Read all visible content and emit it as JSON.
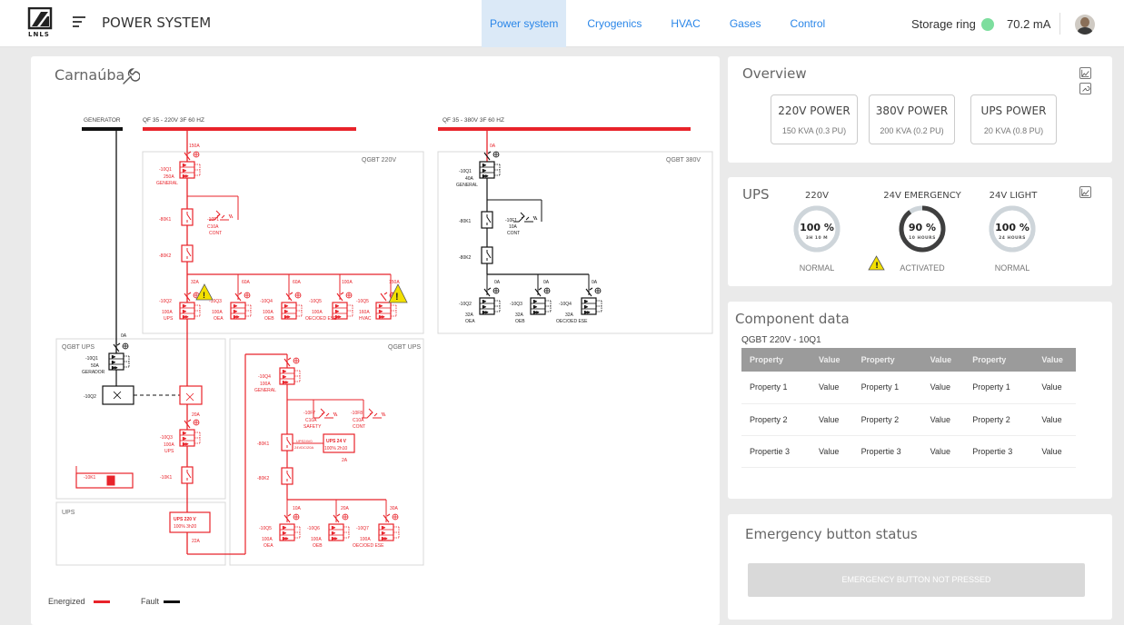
{
  "app": {
    "title": "POWER SYSTEM",
    "logo_text": "LNLS"
  },
  "tabs": [
    {
      "label": "Power system",
      "active": true
    },
    {
      "label": "Cryogenics",
      "active": false
    },
    {
      "label": "HVAC",
      "active": false
    },
    {
      "label": "Gases",
      "active": false
    },
    {
      "label": "Control",
      "active": false
    }
  ],
  "storage_ring": {
    "label": "Storage ring",
    "status_color": "#7dde9e",
    "value": "70.2 mA"
  },
  "colors": {
    "energized": "#e8232a",
    "fault": "#111111",
    "link": "#2a86e8",
    "warning": "#f3e000"
  },
  "left": {
    "title": "Carnaúba",
    "bus_a_label": "QF 35 - 220V 3F 60 HZ",
    "bus_b_label": "QF 35 - 380V 3F 60 HZ",
    "generator_label": "GENERATOR",
    "box_qgbt220": "QGBT 220V",
    "box_qgbt380": "QGBT 380V",
    "box_qgbt_ups_left": "QGBT UPS",
    "box_qgbt_ups_right": "QGBT UPS",
    "box_ups": "UPS",
    "d220": {
      "in_current": "150A",
      "q1": "-10Q1",
      "q1_rating": "250A",
      "q1_sub": "GENERAL",
      "k1": "-80K1",
      "k2": "-80K2",
      "f1": "-10F1",
      "f1_rating": "C10A",
      "f1_sub": "CONT",
      "b1_current": "32A",
      "b2_current": "60A",
      "b3_current": "60A",
      "b4_current": "100A",
      "b5_current": "150A",
      "b1_name": "-10Q2",
      "b1_rating": "100A",
      "b1_sub": "UPS",
      "b2_name": "-10Q3",
      "b2_rating": "100A",
      "b2_sub": "OEA",
      "b3_name": "-10Q4",
      "b3_rating": "100A",
      "b3_sub": "OEB",
      "b4_name": "-10Q5",
      "b4_rating": "100A",
      "b4_sub": "OEC/OED ESE",
      "b5_name": "-10Q5",
      "b5_rating": "160A",
      "b5_sub": "HVAC"
    },
    "d380": {
      "in_current": "0A",
      "q1": "-10Q1",
      "q1_rating": "40A",
      "q1_sub": "GENERAL",
      "k1": "-80K1",
      "k2": "-80K2",
      "f1": "-10F1",
      "f1_rating": "10A",
      "f1_sub": "CONT",
      "b1_current": "0A",
      "b2_current": "0A",
      "b3_current": "0A",
      "b1_name": "-10Q2",
      "b1_rating": "32A",
      "b1_sub": "OEA",
      "b2_name": "-10Q3",
      "b2_rating": "32A",
      "b2_sub": "OEB",
      "b3_name": "-10Q4",
      "b3_rating": "32A",
      "b3_sub": "OEC/OED ESE"
    },
    "ups_left": {
      "gen_current": "0A",
      "q1": "-10Q1",
      "q1_rating": "50A",
      "q1_sub": "GERADOR",
      "q2": "-10Q2",
      "current_20": "20A",
      "q3": "-10Q3",
      "q3_rating": "100A",
      "q3_sub": "UPS",
      "k1": "-10K1",
      "k1b": "-10K1",
      "ups": "UPS 220 V",
      "ups_status": "100% 3h20",
      "ups_current": "22A"
    },
    "ups_right": {
      "q4": "-10Q4",
      "q4_rating": "100A",
      "q4_sub": "GENERAL",
      "f7": "-10F7",
      "f7_rating": "C10A",
      "f7_sub": "SAFETY",
      "f8": "-10F8",
      "f8_rating": "C10A",
      "f8_sub": "CONT",
      "k1": "-80K1",
      "k2": "-80K2",
      "ups_src": "UPS24V0",
      "ups_src_sub": "24VDC/20A",
      "ups24": "UPS 24 V",
      "ups24_status": "100% 2h10",
      "ups24_current": "2A",
      "b1_current": "10A",
      "b2_current": "20A",
      "b3_current": "30A",
      "q5": "-10Q5",
      "q5_rating": "100A",
      "q5_sub": "OEA",
      "q6": "-10Q6",
      "q6_rating": "100A",
      "q6_sub": "OEB",
      "q7": "-10Q7",
      "q7_rating": "100A",
      "q7_sub": "OEC/OED ESE"
    },
    "legend_energized": "Energized",
    "legend_fault": "Fault"
  },
  "overview": {
    "title": "Overview",
    "boxes": [
      {
        "title": "220V POWER",
        "sub": "150 KVA (0.3 PU)"
      },
      {
        "title": "380V POWER",
        "sub": "200 KVA (0.2 PU)"
      },
      {
        "title": "UPS POWER",
        "sub": "20 KVA (0.8 PU)"
      }
    ]
  },
  "ups": {
    "title": "UPS",
    "gauges": [
      {
        "label": "220V",
        "value": "100 %",
        "sub": "3H 10 M",
        "status": "NORMAL",
        "level": 1.0
      },
      {
        "label": "24V EMERGENCY",
        "value": "90 %",
        "sub": "10 HOURS",
        "status": "ACTIVATED",
        "level": 0.9
      },
      {
        "label": "24V LIGHT",
        "value": "100 %",
        "sub": "24 HOURS",
        "status": "NORMAL",
        "level": 1.0
      }
    ]
  },
  "component": {
    "title": "Component data",
    "subtitle": "QGBT 220V - 10Q1",
    "headers": [
      "Property",
      "Value",
      "Property",
      "Value",
      "Property",
      "Value"
    ],
    "rows": [
      [
        "Property 1",
        "Value",
        "Property 1",
        "Value",
        "Property 1",
        "Value"
      ],
      [
        "Property 2",
        "Value",
        "Property 2",
        "Value",
        "Property 2",
        "Value"
      ],
      [
        "Propertie 3",
        "Value",
        "Propertie 3",
        "Value",
        "Propertie 3",
        "Value"
      ]
    ]
  },
  "emergency": {
    "title": "Emergency button status",
    "button": "EMERGENCY BUTTON NOT PRESSED"
  }
}
